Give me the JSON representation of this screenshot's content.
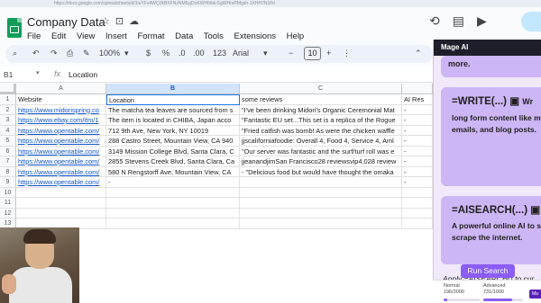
{
  "browser": {
    "url": "https://docs.google.com/spreadsheets/d/1iuYFv4WQ2kBXFNzNM5yjDoKWHIhbk-5gWHrsRMgsh-1XHH7N1f/d"
  },
  "doc": {
    "title": "Company Data"
  },
  "menu": [
    "File",
    "Edit",
    "View",
    "Insert",
    "Format",
    "Data",
    "Tools",
    "Extensions",
    "Help"
  ],
  "toolbar": {
    "zoom": "100%",
    "currency": "$",
    "percent": "%",
    "dec_decrease": ".0",
    "dec_increase": ".00",
    "number_fmt": "123",
    "font": "Arial",
    "font_size": "10"
  },
  "formula_bar": {
    "cell_ref": "B1",
    "fx": "fx",
    "value": "Location"
  },
  "columns": [
    "A",
    "B",
    "C"
  ],
  "rows": [
    {
      "num": "1",
      "a": "Website",
      "b": "Location",
      "c": "some reviews",
      "d": "AI Res"
    },
    {
      "num": "2",
      "a": "https://www.midorispring.co",
      "b": "The matcha tea leaves are sourced from s",
      "c": "\"I've been drinking Midori's Organic Ceremonial Mat",
      "d": "-"
    },
    {
      "num": "3",
      "a": "https://www.ebay.com/itm/1",
      "b": "The item is located in CHIBA, Japan acco",
      "c": "\"Fantastic EU set...This set is a replica of the Rogue",
      "d": "-"
    },
    {
      "num": "4",
      "a": "https://www.opentable.com/",
      "b": "712 9th Ave, New York, NY 10019",
      "c": "\"Fried catfish was bomb! As were the chicken waffle",
      "d": "-"
    },
    {
      "num": "5",
      "a": "https://www.opentable.com/",
      "b": "288 Castro Street, Mountain View, CA 940",
      "c": "jjscaliforniafoodie: Overall 4, Food 4, Service 4, Aml",
      "d": "-"
    },
    {
      "num": "6",
      "a": "https://www.opentable.com/",
      "b": "3149 Mission College Blvd, Santa Clara, C",
      "c": "\"Our server was fantastic and the surf/turf roll was e",
      "d": "-"
    },
    {
      "num": "7",
      "a": "https://www.opentable.com/",
      "b": "2855 Stevens Creek Blvd, Santa Clara, Ca",
      "c": "jjeanandjimSan Francisco28 reviewsvip4.028 review",
      "d": "-"
    },
    {
      "num": "8",
      "a": "https://www.opentable.com/",
      "b": "580 N Rengstorff Ave, Mountain View, CA",
      "c": "- \"Delicious food but would have thought the omaka",
      "d": "-"
    },
    {
      "num": "9",
      "a": "https://www.opentable.com/",
      "b": "-",
      "c": "",
      "d": "-"
    },
    {
      "num": "10",
      "a": "",
      "b": "",
      "c": "",
      "d": ""
    },
    {
      "num": "11",
      "a": "",
      "b": "",
      "c": "",
      "d": ""
    },
    {
      "num": "12",
      "a": "",
      "b": "",
      "c": "",
      "d": ""
    },
    {
      "num": "13",
      "a": "",
      "b": "",
      "c": "",
      "d": ""
    }
  ],
  "side_panel": {
    "title": "Mage AI",
    "card1_text": "more.",
    "write_fn": "=WRITE(...)",
    "write_desc": "long form content like messages, emails, and blog posts.",
    "write_prefix": "Wr",
    "aisearch_fn": "=AISEARCH(...)",
    "aisearch_desc": "A powerful online AI to search and scrape the internet.",
    "apply_text": "Apply =AISEARCH() to cur selected cells:",
    "run_button": "Run Search",
    "normal_label": "Normal",
    "normal_count": "196/2000",
    "normal_fraction": 0.098,
    "advanced_label": "Advanced",
    "advanced_count": "731/1000",
    "advanced_fraction": 0.731,
    "badge": "Ma"
  },
  "colors": {
    "accent": "#8b5cf6",
    "card": "#cdb6f5",
    "link": "#1155cc",
    "selection": "#1a73e8"
  }
}
